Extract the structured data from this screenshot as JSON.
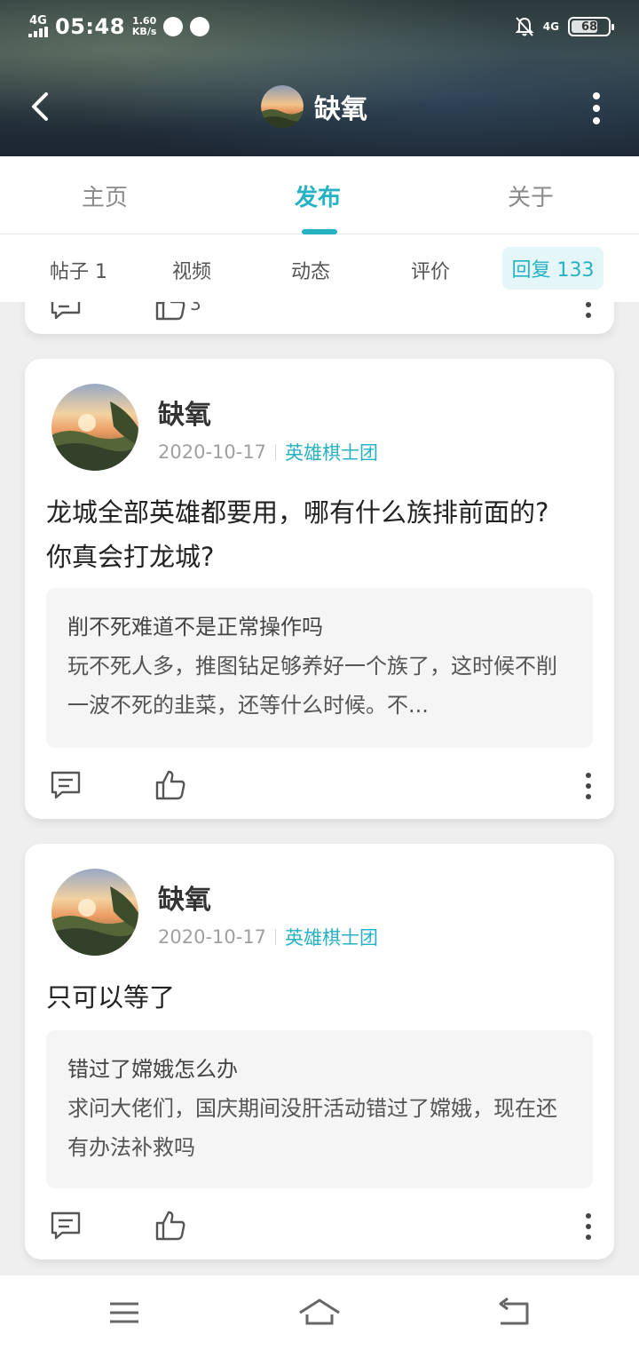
{
  "status_bar": {
    "network_left": "4G",
    "time": "05:48",
    "speed_value": "1.60",
    "speed_unit": "KB/s",
    "network_right": "4G",
    "battery": "68"
  },
  "header": {
    "back_icon": "chevron-left-icon",
    "title": "缺氧",
    "more_icon": "more-vertical-icon"
  },
  "tabs": [
    {
      "label": "主页",
      "active": false
    },
    {
      "label": "发布",
      "active": true
    },
    {
      "label": "关于",
      "active": false
    }
  ],
  "subtabs": [
    {
      "label": "帖子 1"
    },
    {
      "label": "视频"
    },
    {
      "label": "动态"
    },
    {
      "label": "评价"
    },
    {
      "label": "回复 133",
      "active": true
    }
  ],
  "posts": [
    {
      "author": "缺氧",
      "date": "2020-10-17",
      "group": "英雄棋士团",
      "content": "龙城全部英雄都要用，哪有什么族排前面的?你真会打龙城?",
      "quote_title": "削不死难道不是正常操作吗",
      "quote_body": "玩不死人多，推图钻足够养好一个族了，这时候不削一波不死的韭菜，还等什么时候。不..."
    },
    {
      "author": "缺氧",
      "date": "2020-10-17",
      "group": "英雄棋士团",
      "content": "只可以等了",
      "quote_title": "错过了嫦娥怎么办",
      "quote_body": "求问大佬们，国庆期间没肝活动错过了嫦娥，现在还有办法补救吗"
    }
  ],
  "partial_card": {
    "like_count": "3"
  },
  "colors": {
    "accent": "#27b2c4",
    "page_bg": "#efefef",
    "quote_bg": "#f5f5f5"
  },
  "bottom_nav": {
    "menu_icon": "menu-icon",
    "home_icon": "home-icon",
    "back_icon": "return-icon"
  }
}
